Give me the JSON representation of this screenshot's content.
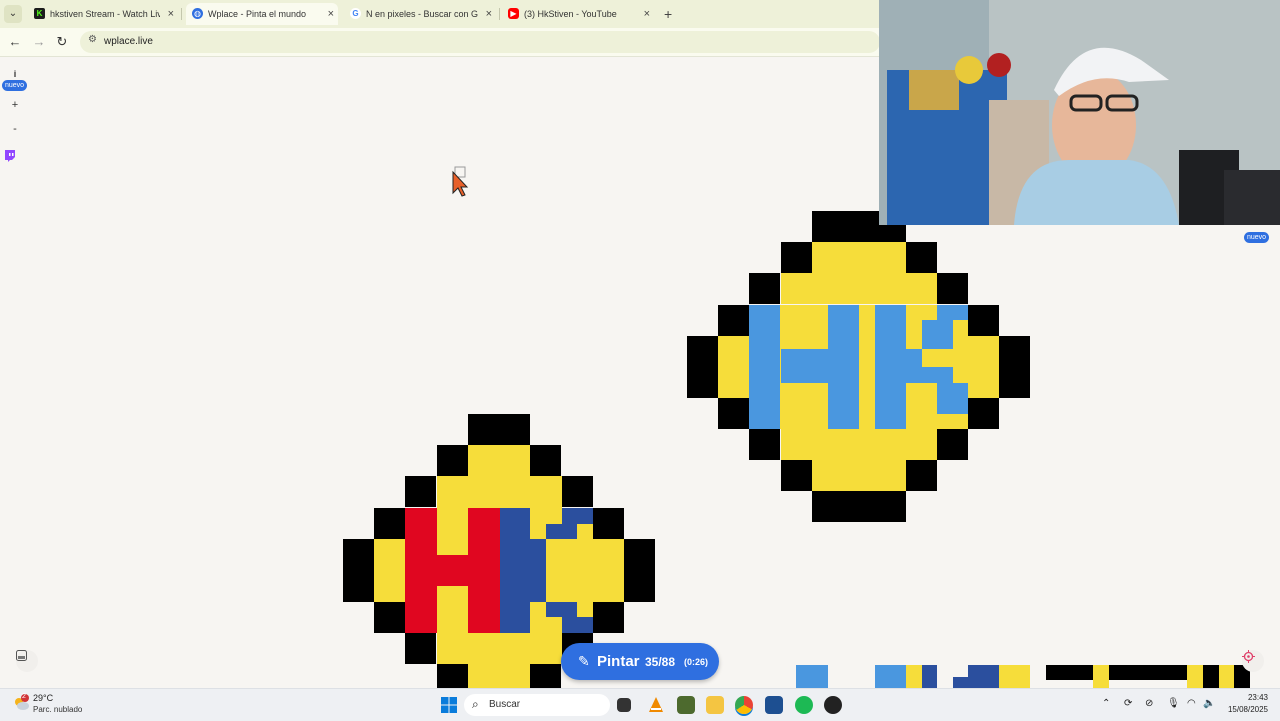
{
  "browser": {
    "tabs": [
      {
        "title": "hkstiven Stream - Watch Live o",
        "favicon": "kick-logo",
        "favicon_color": "#53fc18",
        "active": false
      },
      {
        "title": "Wplace - Pinta el mundo",
        "favicon": "globe-icon",
        "favicon_color": "#2f6fe0",
        "active": true
      },
      {
        "title": "N en pixeles - Buscar con Goog",
        "favicon": "google-logo",
        "favicon_color": "#4285f4",
        "active": false
      },
      {
        "title": "(3) HkStiven - YouTube",
        "favicon": "youtube-logo",
        "favicon_color": "#ff0000",
        "active": false
      }
    ],
    "new_tab_label": "+",
    "url": "wplace.live",
    "nav": {
      "back": "←",
      "forward": "→",
      "reload": "↻",
      "site_info": "⚙"
    },
    "tab_menu": "⌄",
    "close_glyph": "×"
  },
  "page": {
    "side_controls": {
      "info": "i",
      "info_badge": "nuevo",
      "zoom_in": "+",
      "zoom_out": "-",
      "twitch": "twitch-icon"
    },
    "right_badge": "nuevo",
    "paint_button": {
      "label": "Pintar",
      "charges": "35/88",
      "timer": "(0:26)"
    },
    "colors": {
      "background": "#f7f5f2",
      "black": "#000000",
      "yellow": "#f6dd3a",
      "light_blue": "#4a97df",
      "red": "#e00620",
      "dark_blue": "#2b4f9e",
      "accent": "#2f6fe0"
    }
  },
  "taskbar": {
    "weather": {
      "temp": "29°C",
      "desc": "Parc. nublado",
      "alert": "2"
    },
    "search_placeholder": "Buscar",
    "time": "23:43",
    "date": "15/08/2025"
  }
}
